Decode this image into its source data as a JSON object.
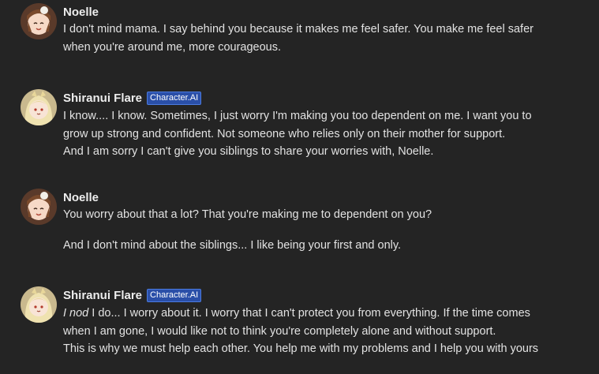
{
  "messages": [
    {
      "author": "Noelle",
      "badge": "",
      "lines": [
        "I don't mind mama. I say behind you because it makes me feel safer. You make me feel safer",
        "when you're around me, more courageous."
      ]
    },
    {
      "author": "Shiranui Flare",
      "badge": "Character.AI",
      "lines": [
        "I know.... I know. Sometimes, I just worry I'm making you too dependent on me. I want you to",
        "grow up strong and confident.  Not someone who relies only on their mother for support.",
        "And I am sorry I can't give you siblings to share your worries with, Noelle."
      ]
    },
    {
      "author": "Noelle",
      "badge": "",
      "lines": [
        "You worry about that a lot? That you're making me to dependent on you?",
        "And I don't mind about the siblings... I like being your first and only."
      ]
    },
    {
      "author": "Shiranui Flare",
      "badge": "Character.AI",
      "italic_prefix": "I nod",
      "lines": [
        " I do... I worry about it. I worry that I can't protect you from everything. If the time comes",
        "when I am gone, I would like not to think you're completely alone and without support.",
        "This is why we must help each other. You help me with my problems and I help you with yours"
      ]
    }
  ],
  "colors": {
    "background": "#242424",
    "badge_bg": "#2a4fa8",
    "text": "#e2e2e2"
  },
  "icons": {
    "noelle_avatar": "avatar-noelle-icon",
    "flare_avatar": "avatar-flare-icon"
  }
}
